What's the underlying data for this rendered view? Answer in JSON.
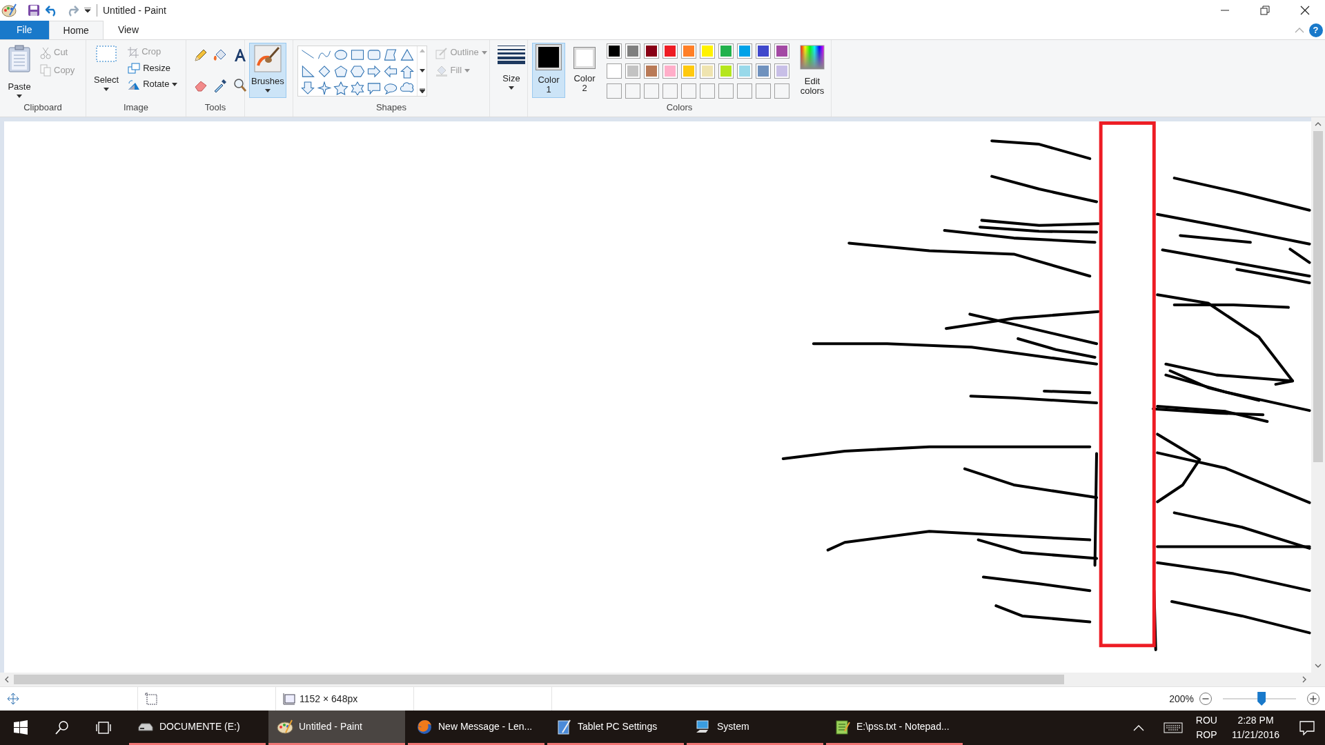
{
  "window": {
    "title": "Untitled - Paint"
  },
  "tabs": [
    {
      "label": "File",
      "kind": "file",
      "selected": false
    },
    {
      "label": "Home",
      "kind": "tab",
      "selected": true
    },
    {
      "label": "View",
      "kind": "tab",
      "selected": false
    }
  ],
  "help": {
    "label": "?"
  },
  "clipboard": {
    "caption": "Clipboard",
    "buttons": [
      {
        "label": "Paste",
        "kind": "large",
        "disabled": false
      },
      {
        "label": "Cut",
        "kind": "small",
        "disabled": true
      },
      {
        "label": "Copy",
        "kind": "small",
        "disabled": true
      }
    ]
  },
  "image": {
    "caption": "Image",
    "buttons": [
      {
        "label": "Select",
        "kind": "large",
        "disabled": false
      },
      {
        "label": "Crop",
        "kind": "small",
        "disabled": true
      },
      {
        "label": "Resize",
        "kind": "small",
        "disabled": false
      },
      {
        "label": "Rotate",
        "kind": "small",
        "disabled": false
      }
    ]
  },
  "tools": {
    "caption": "Tools"
  },
  "brushes": {
    "label": "Brushes",
    "selected": true
  },
  "shapes": {
    "caption": "Shapes",
    "outline": {
      "label": "Outline",
      "disabled": true
    },
    "fill": {
      "label": "Fill",
      "disabled": true
    }
  },
  "size": {
    "label": "Size"
  },
  "colors": {
    "caption": "Colors",
    "color1": {
      "label": "Color 1",
      "color": "#000000",
      "selected": true
    },
    "color2": {
      "label": "Color 2",
      "color": "#ffffff",
      "selected": false
    },
    "palette": [
      {
        "color": "#000000"
      },
      {
        "color": "#7f7f7f"
      },
      {
        "color": "#880015"
      },
      {
        "color": "#ed1c24"
      },
      {
        "color": "#ff7f27"
      },
      {
        "color": "#fff200"
      },
      {
        "color": "#22b14c"
      },
      {
        "color": "#00a2e8"
      },
      {
        "color": "#3f48cc"
      },
      {
        "color": "#a349a4"
      },
      {
        "color": "#ffffff"
      },
      {
        "color": "#c3c3c3"
      },
      {
        "color": "#b97a57"
      },
      {
        "color": "#ffaec9"
      },
      {
        "color": "#ffc90e"
      },
      {
        "color": "#efe4b0"
      },
      {
        "color": "#b5e61d"
      },
      {
        "color": "#99d9ea"
      },
      {
        "color": "#7092be"
      },
      {
        "color": "#c8bfe7"
      }
    ],
    "edit_colors": "Edit colors"
  },
  "status": {
    "canvas_size": "1152 × 648px",
    "zoom": {
      "reading": "200%",
      "level": 0.53
    }
  },
  "taskbar": {
    "apps": [
      {
        "label": "DOCUMENTE (E:)",
        "selected": false
      },
      {
        "label": "Untitled - Paint",
        "selected": true
      },
      {
        "label": "New Message - Len...",
        "selected": false
      },
      {
        "label": "Tablet PC Settings",
        "selected": false
      },
      {
        "label": "System",
        "selected": false
      },
      {
        "label": "E:\\pss.txt - Notepad...",
        "selected": false
      }
    ],
    "tray": {
      "lang_primary": "ROU",
      "lang_secondary": "ROP",
      "time": "2:28 PM",
      "date": "11/21/2016"
    }
  }
}
